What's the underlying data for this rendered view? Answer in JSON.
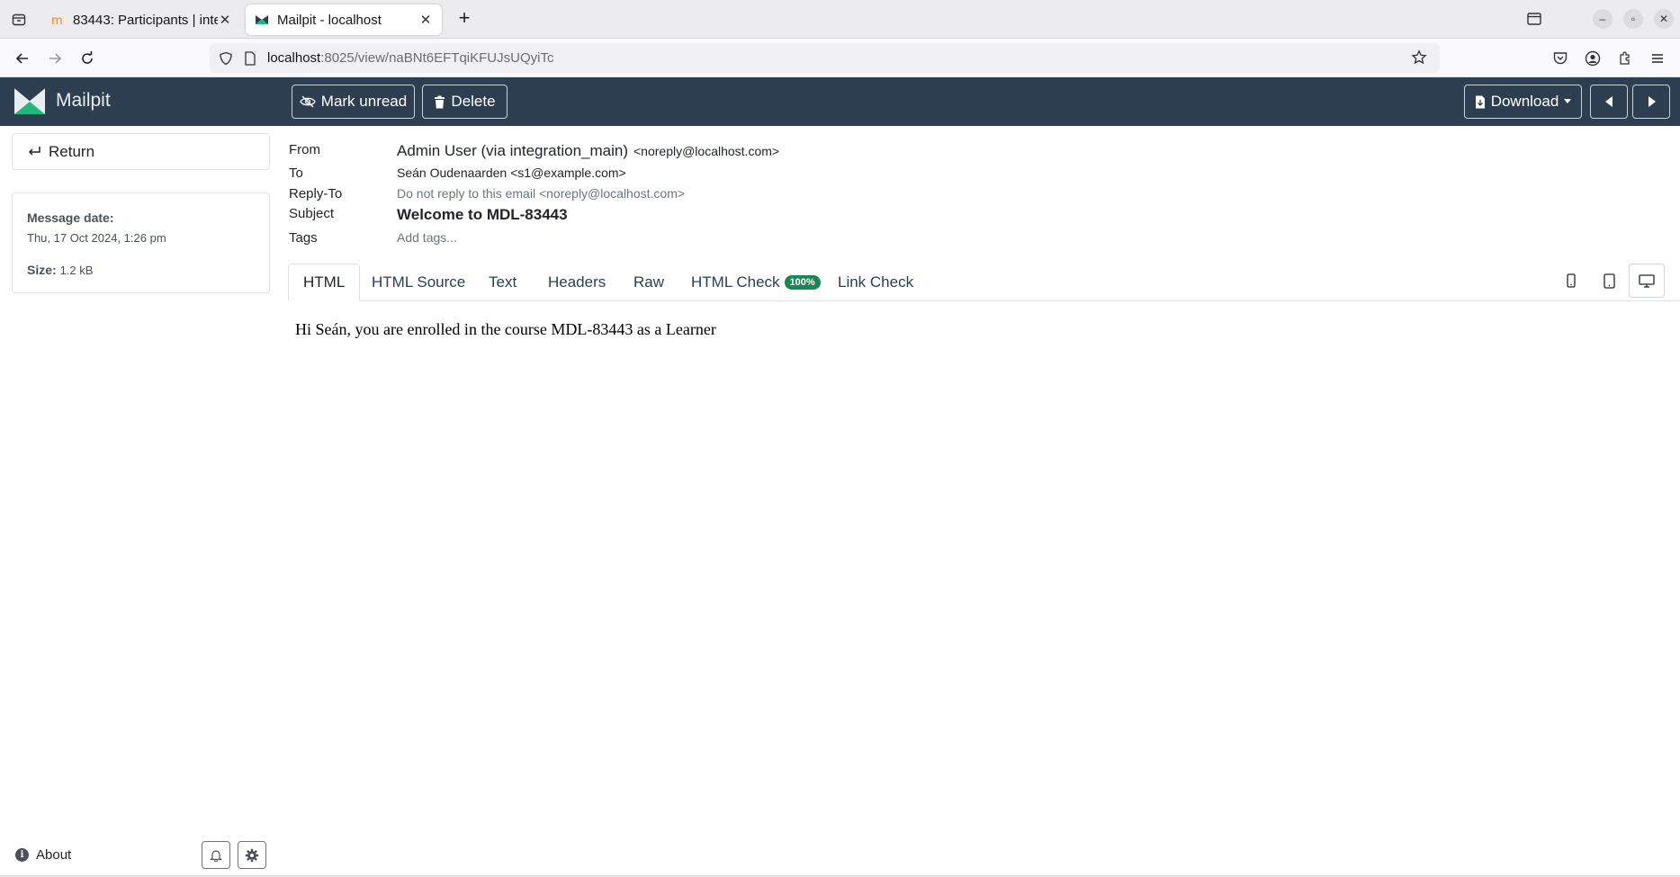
{
  "browser": {
    "tabs": [
      {
        "title": "83443: Participants | inte",
        "active": false
      },
      {
        "title": "Mailpit - localhost",
        "active": true
      }
    ],
    "url_host": "localhost",
    "url_path": ":8025/view/naBNt6EFTqiKFUJsUQyiTc"
  },
  "app": {
    "name": "Mailpit",
    "toolbar": {
      "mark_unread": "Mark unread",
      "delete": "Delete",
      "download": "Download"
    }
  },
  "sidebar": {
    "return_label": "Return",
    "message_date_label": "Message date:",
    "message_date": "Thu, 17 Oct 2024, 1:26 pm",
    "size_label": "Size:",
    "size_value": "1.2 kB",
    "about_label": "About"
  },
  "message": {
    "labels": {
      "from": "From",
      "to": "To",
      "reply_to": "Reply-To",
      "subject": "Subject",
      "tags": "Tags"
    },
    "from_name": "Admin User (via integration_main)",
    "from_email": "<noreply@localhost.com>",
    "to": "Seán Oudenaarden <s1@example.com>",
    "reply_to": "Do not reply to this email <noreply@localhost.com>",
    "subject": "Welcome to MDL-83443",
    "tags_placeholder": "Add tags..."
  },
  "tabs": {
    "html": "HTML",
    "html_source": "HTML Source",
    "text": "Text",
    "headers": "Headers",
    "raw": "Raw",
    "html_check": "HTML Check",
    "html_check_badge": "100%",
    "link_check": "Link Check"
  },
  "body": {
    "text": "Hi Seán, you are enrolled in the course MDL-83443 as a Learner"
  },
  "colors": {
    "header_bg": "#2c3e50",
    "badge_green": "#198754",
    "logo_green": "#23b77e"
  }
}
